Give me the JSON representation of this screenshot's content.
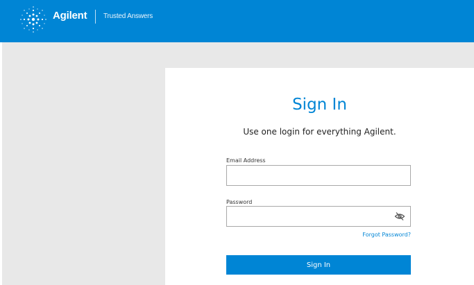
{
  "header": {
    "brand": "Agilent",
    "tagline": "Trusted Answers",
    "logo_icon": "spark-logo-icon",
    "background_color": "#0085d5"
  },
  "signin": {
    "title": "Sign In",
    "subtitle": "Use one login for everything Agilent.",
    "email_label": "Email Address",
    "email_value": "",
    "password_label": "Password",
    "password_value": "",
    "password_toggle_icon": "eye-slash-icon",
    "forgot_link": "Forgot Password?",
    "submit_label": "Sign In",
    "accent_color": "#0085d5"
  }
}
